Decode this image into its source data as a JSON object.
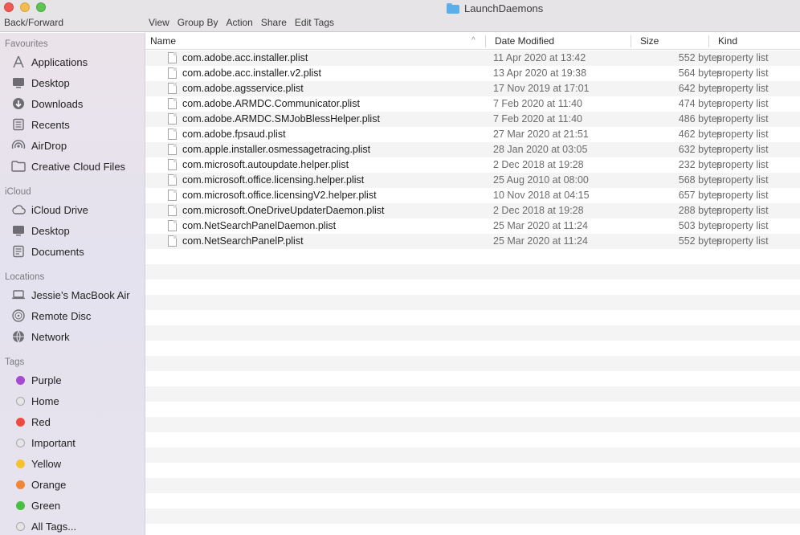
{
  "window": {
    "title": "LaunchDaemons",
    "back_forward_label": "Back/Forward"
  },
  "toolbar": {
    "view": "View",
    "group_by": "Group By",
    "action": "Action",
    "share": "Share",
    "edit_tags": "Edit Tags"
  },
  "sidebar": {
    "favourites_heading": "Favourites",
    "favourites": [
      {
        "label": "Applications",
        "icon": "applications-icon"
      },
      {
        "label": "Desktop",
        "icon": "desktop-icon"
      },
      {
        "label": "Downloads",
        "icon": "downloads-icon"
      },
      {
        "label": "Recents",
        "icon": "recents-icon"
      },
      {
        "label": "AirDrop",
        "icon": "airdrop-icon"
      },
      {
        "label": "Creative Cloud Files",
        "icon": "folder-icon"
      }
    ],
    "icloud_heading": "iCloud",
    "icloud": [
      {
        "label": "iCloud Drive",
        "icon": "cloud-icon"
      },
      {
        "label": "Desktop",
        "icon": "desktop-icon"
      },
      {
        "label": "Documents",
        "icon": "documents-icon"
      }
    ],
    "locations_heading": "Locations",
    "locations": [
      {
        "label": "Jessie’s MacBook Air",
        "icon": "laptop-icon"
      },
      {
        "label": "Remote Disc",
        "icon": "disc-icon"
      },
      {
        "label": "Network",
        "icon": "network-icon"
      }
    ],
    "tags_heading": "Tags",
    "tags": [
      {
        "label": "Purple",
        "color": "#a64ad1"
      },
      {
        "label": "Home",
        "color": "#d1d1d4"
      },
      {
        "label": "Red",
        "color": "#ef4a41"
      },
      {
        "label": "Important",
        "color": "#d1d1d4"
      },
      {
        "label": "Yellow",
        "color": "#f6c230"
      },
      {
        "label": "Orange",
        "color": "#f38634"
      },
      {
        "label": "Green",
        "color": "#48be44"
      },
      {
        "label": "All Tags...",
        "color": "#d1d1d4"
      }
    ]
  },
  "columns": {
    "name": "Name",
    "date_modified": "Date Modified",
    "size": "Size",
    "kind": "Kind"
  },
  "files": [
    {
      "name": "com.adobe.acc.installer.plist",
      "date": "11 Apr 2020 at 13:42",
      "size": "552 bytes",
      "kind": "property list"
    },
    {
      "name": "com.adobe.acc.installer.v2.plist",
      "date": "13 Apr 2020 at 19:38",
      "size": "564 bytes",
      "kind": "property list"
    },
    {
      "name": "com.adobe.agsservice.plist",
      "date": "17 Nov 2019 at 17:01",
      "size": "642 bytes",
      "kind": "property list"
    },
    {
      "name": "com.adobe.ARMDC.Communicator.plist",
      "date": "7 Feb 2020 at 11:40",
      "size": "474 bytes",
      "kind": "property list"
    },
    {
      "name": "com.adobe.ARMDC.SMJobBlessHelper.plist",
      "date": "7 Feb 2020 at 11:40",
      "size": "486 bytes",
      "kind": "property list"
    },
    {
      "name": "com.adobe.fpsaud.plist",
      "date": "27 Mar 2020 at 21:51",
      "size": "462 bytes",
      "kind": "property list"
    },
    {
      "name": "com.apple.installer.osmessagetracing.plist",
      "date": "28 Jan 2020 at 03:05",
      "size": "632 bytes",
      "kind": "property list"
    },
    {
      "name": "com.microsoft.autoupdate.helper.plist",
      "date": "2 Dec 2018 at 19:28",
      "size": "232 bytes",
      "kind": "property list"
    },
    {
      "name": "com.microsoft.office.licensing.helper.plist",
      "date": "25 Aug 2010 at 08:00",
      "size": "568 bytes",
      "kind": "property list"
    },
    {
      "name": "com.microsoft.office.licensingV2.helper.plist",
      "date": "10 Nov 2018 at 04:15",
      "size": "657 bytes",
      "kind": "property list"
    },
    {
      "name": "com.microsoft.OneDriveUpdaterDaemon.plist",
      "date": "2 Dec 2018 at 19:28",
      "size": "288 bytes",
      "kind": "property list"
    },
    {
      "name": "com.NetSearchPanelDaemon.plist",
      "date": "25 Mar 2020 at 11:24",
      "size": "503 bytes",
      "kind": "property list"
    },
    {
      "name": "com.NetSearchPanelP.plist",
      "date": "25 Mar 2020 at 11:24",
      "size": "552 bytes",
      "kind": "property list"
    }
  ]
}
